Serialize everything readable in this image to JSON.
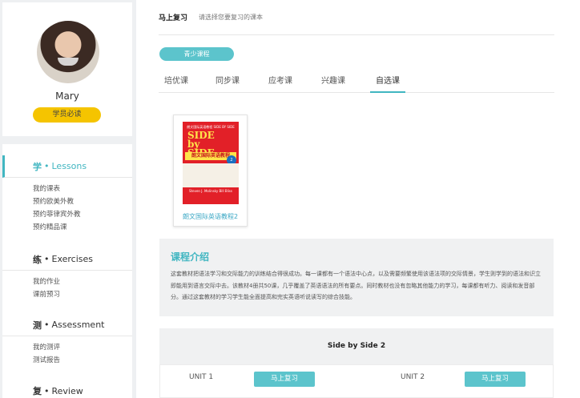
{
  "profile": {
    "username": "Mary",
    "badge_label": "学员必读"
  },
  "nav": {
    "sections": [
      {
        "zh": "学",
        "en": "Lessons",
        "items": [
          "我的课表",
          "预约欧美外教",
          "预约菲律宾外教",
          "预约精品课"
        ]
      },
      {
        "zh": "练",
        "en": "Exercises",
        "items": [
          "我的作业",
          "课前预习"
        ]
      },
      {
        "zh": "测",
        "en": "Assessment",
        "items": [
          "我的测评",
          "测试报告"
        ]
      },
      {
        "zh": "复",
        "en": "Review",
        "items": []
      }
    ],
    "dot": "•"
  },
  "header": {
    "title": "马上复习",
    "hint": "请选择您要复习的课本"
  },
  "course_type": "青少课程",
  "tabs": [
    "培优课",
    "同步课",
    "应考课",
    "兴趣课",
    "自选课"
  ],
  "active_tab": "自选课",
  "book": {
    "title": "朗文国际英语教程2",
    "cover": {
      "top_text": "朗文国际英语教程 SIDE BY SIDE",
      "logo_line1": "SIDE",
      "logo_line2": "by SIDE",
      "cn_title": "朗文国际英语教程",
      "bottom_text": "Steven J. Molinsky Bill Bliss",
      "level": "2"
    }
  },
  "intro": {
    "title": "课程介绍",
    "body": "这套教材把语法学习和交际能力的训练结合得很成功。每一课都有一个语法中心点，以及需要频繁使用该语法项的交际情景，学生则学到的语法和识立即能用到语言交际中去。该教材4册共50课，几乎覆盖了英语语法的所有要点。同时教材也没有忽略其他能力的学习，每课都有听力、阅读和发音部分。通过这套教材的学习学生能全面提高和完实英语听说读写的综合技能。"
  },
  "units": {
    "heading": "Side by Side 2",
    "rows": [
      {
        "label": "UNIT 1",
        "button": "马上复习"
      },
      {
        "label": "UNIT 2",
        "button": "马上复习"
      }
    ]
  },
  "colors": {
    "accent": "#41b6c1",
    "button": "#5cc4cc",
    "badge": "#f5c400"
  }
}
